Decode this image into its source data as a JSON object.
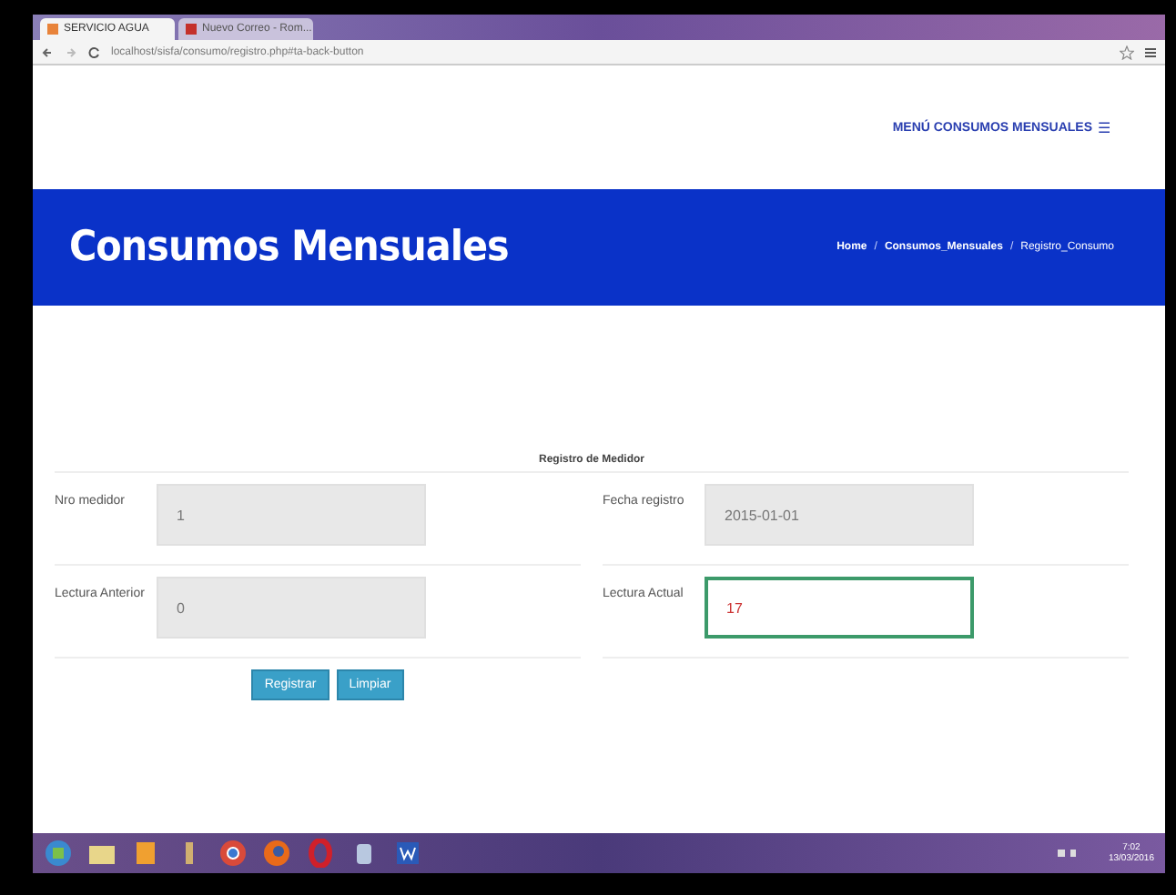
{
  "browser": {
    "tabs": [
      {
        "label": "SERVICIO AGUA",
        "selected": true
      },
      {
        "label": "Nuevo Correo - Rom...",
        "selected": false
      }
    ],
    "address": "localhost/sisfa/consumo/registro.php#ta-back-button"
  },
  "nav": {
    "menu": "MENÚ CONSUMOS MENSUALES",
    "menu_icon": "☰"
  },
  "banner": {
    "title": "Consumos Mensuales",
    "breadcrumb": [
      "Home",
      "Consumos_Mensuales",
      "Registro_Consumo"
    ],
    "separator": "/"
  },
  "form": {
    "title": "Registro de Medidor",
    "fields": [
      {
        "label": "Nro medidor",
        "value": "1",
        "disabled": true,
        "focused": false
      },
      {
        "label": "Fecha registro",
        "value": "2015-01-01",
        "disabled": true,
        "focused": false
      },
      {
        "label": "Lectura Anterior",
        "value": "0",
        "disabled": true,
        "focused": false
      },
      {
        "label": "Lectura Actual",
        "value": "17",
        "disabled": false,
        "focused": true
      }
    ],
    "buttons": [
      "Registrar",
      "Limpiar"
    ]
  },
  "taskbar": {
    "time": "7:02",
    "date": "13/03/2016"
  }
}
